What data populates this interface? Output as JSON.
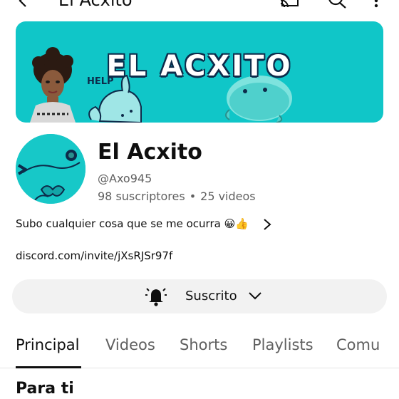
{
  "header": {
    "title": "El Acxito",
    "icons": [
      "back-arrow-icon",
      "cast-icon",
      "search-icon",
      "more-vert-icon"
    ]
  },
  "banner": {
    "text": "EL ACXITO",
    "help_text": "HELP"
  },
  "channel": {
    "name": "El Acxito",
    "handle": "@Axo945",
    "subscribers": "98 suscriptores",
    "separator": "•",
    "videos": "25 videos",
    "description": "Subo cualquier cosa que se me ocurra 😀👍",
    "link": "discord.com/invite/jXsRJSr97f"
  },
  "subscribe_button": {
    "label": "Suscrito",
    "icons": [
      "bell-icon",
      "chevron-down-icon"
    ]
  },
  "tabs": [
    {
      "label": "Principal",
      "active": true
    },
    {
      "label": "Videos",
      "active": false
    },
    {
      "label": "Shorts",
      "active": false
    },
    {
      "label": "Playlists",
      "active": false
    },
    {
      "label": "Comu",
      "active": false
    }
  ],
  "section": {
    "title": "Para ti"
  },
  "colors": {
    "banner_bg": "#10c6c8",
    "avatar_bg": "#17c8c8",
    "button_bg": "#f2f2f2",
    "text_primary": "#0f0f0f",
    "text_secondary": "#606060"
  }
}
